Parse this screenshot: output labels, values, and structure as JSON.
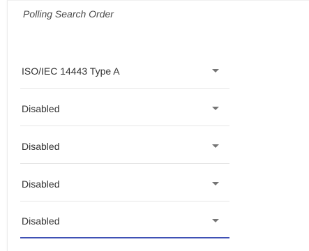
{
  "panel": {
    "title": "Polling Search Order"
  },
  "selects": [
    {
      "value": "ISO/IEC 14443 Type A",
      "icon": "chevron-down-icon"
    },
    {
      "value": "Disabled",
      "icon": "chevron-down-icon"
    },
    {
      "value": "Disabled",
      "icon": "chevron-down-icon"
    },
    {
      "value": "Disabled",
      "icon": "chevron-down-icon"
    },
    {
      "value": "Disabled",
      "icon": "chevron-down-icon"
    }
  ],
  "colors": {
    "accent": "#3f51b5",
    "divider": "#e6e6e6",
    "text": "#333333"
  }
}
